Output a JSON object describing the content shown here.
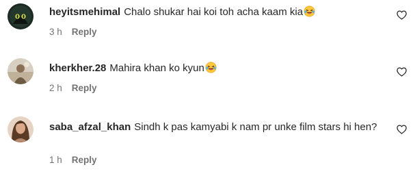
{
  "comments": [
    {
      "username": "heyitsmehimal",
      "text": "Chalo shukar hai koi toh acha kaam kia",
      "emoji": "laughing-tears-emoji",
      "time": "3 h",
      "reply_label": "Reply",
      "like_icon": "heart-outline-icon"
    },
    {
      "username": "kherkher.28",
      "text": "Mahira khan ko kyun",
      "emoji": "laughing-tears-emoji",
      "time": "2 h",
      "reply_label": "Reply",
      "like_icon": "heart-outline-icon"
    },
    {
      "username": "saba_afzal_khan",
      "text": "Sindh k pas kamyabi k nam pr unke film stars hi hen?",
      "time": "1 h",
      "reply_label": "Reply",
      "like_icon": "heart-outline-icon"
    }
  ],
  "colors": {
    "text": "#262626",
    "secondary_text": "#737373",
    "background": "#ffffff",
    "emoji_face": "#FFC83D"
  }
}
